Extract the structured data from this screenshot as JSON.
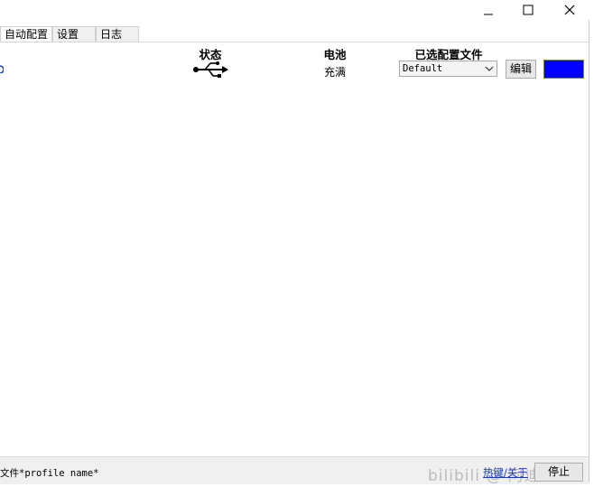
{
  "window": {
    "controls": {
      "minimize": "—",
      "maximize": "☐",
      "close": "✕"
    }
  },
  "tabs": [
    {
      "label": "自动配置"
    },
    {
      "label": "设置"
    },
    {
      "label": "日志"
    }
  ],
  "columns": {
    "status": "状态",
    "battery": "电池",
    "profile": "已选配置文件"
  },
  "device_row": {
    "left_marker": "",
    "status_icon": "usb-icon",
    "battery_value": "充满",
    "profile_selected": "Default",
    "edit_label": "编辑",
    "color": "#0000ff"
  },
  "footer": {
    "profile_text": "文件*profile name*",
    "link_label": "热键/关于",
    "stop_label": "停止",
    "watermark": "bilibili @ 阿迪kk"
  }
}
